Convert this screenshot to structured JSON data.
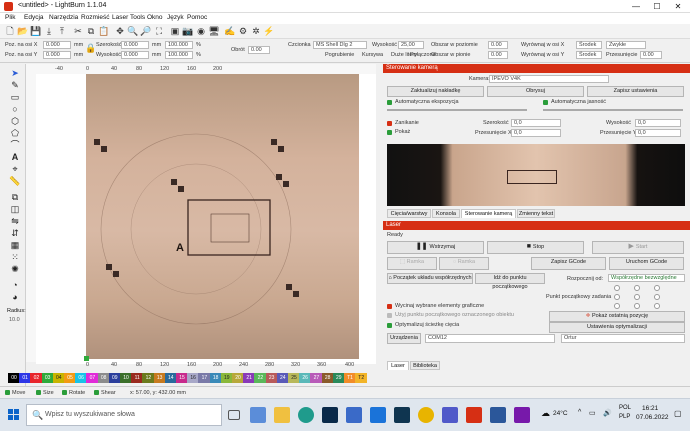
{
  "window": {
    "title": "<untitled> - LightBurn 1.1.04",
    "min": "—",
    "max": "☐",
    "close": "✕"
  },
  "menu": [
    "Plik",
    "Edycja",
    "Narzędzia",
    "Rozmieść",
    "Laser Tools",
    "Okno",
    "Język",
    "Pomoc"
  ],
  "toolbar2": {
    "pos_x_label": "Poz. na osi X",
    "pos_x": "0.000",
    "pos_y_label": "Poz. na osi Y",
    "pos_y": "0.000",
    "unit": "mm",
    "width_label": "Szerokość",
    "width": "0.000",
    "height_label": "Wysokość",
    "height": "0.000",
    "scale_w": "100.000",
    "scale_h": "100.000",
    "pct": "%",
    "rotate_label": "Obrót",
    "rotate": "0.00",
    "font_label": "Czcionka",
    "font": "MS Shell Dlg 2",
    "font_height_label": "Wysokość",
    "font_height": "25,00",
    "hspace_label": "Obszar w poziomie",
    "hspace": "0.00",
    "vspace_label": "Obszar w pionie",
    "vspace": "0.00",
    "bold": "Pogrubienie",
    "italic": "Kursywa",
    "upper": "Duże litery",
    "welded": "Połączone",
    "align_x_label": "Wyrównaj w osi X",
    "align_x": "Środek",
    "align_y_label": "Wyrównaj w osi Y",
    "align_y": "Środek",
    "normal": "Zwykłe",
    "offset_label": "Przesunięcie",
    "offset": "0.00"
  },
  "rulers": {
    "top": [
      "-40",
      "0",
      "40",
      "80",
      "120",
      "160",
      "200",
      "240",
      "280",
      "320",
      "360",
      "400"
    ],
    "left": [
      "400",
      "360",
      "320",
      "280",
      "240",
      "200",
      "160",
      "120",
      "80",
      "40",
      "0"
    ],
    "bottom": [
      "-40",
      "0",
      "40",
      "80",
      "120",
      "160",
      "200",
      "240",
      "280",
      "320",
      "360",
      "400"
    ]
  },
  "radius": {
    "label": "Radius:",
    "value": "10.0"
  },
  "canvas": {
    "marker": "A"
  },
  "palette": [
    {
      "n": "00",
      "c": "#000000"
    },
    {
      "n": "01",
      "c": "#2d36e6"
    },
    {
      "n": "02",
      "c": "#e8252b"
    },
    {
      "n": "03",
      "c": "#2faa3a"
    },
    {
      "n": "04",
      "c": "#c8b400"
    },
    {
      "n": "05",
      "c": "#f29a14"
    },
    {
      "n": "06",
      "c": "#19c3e8"
    },
    {
      "n": "07",
      "c": "#e12ad8"
    },
    {
      "n": "08",
      "c": "#8c8c8c"
    },
    {
      "n": "09",
      "c": "#2c3f9c"
    },
    {
      "n": "10",
      "c": "#3b6f2a"
    },
    {
      "n": "11",
      "c": "#9a2a1e"
    },
    {
      "n": "12",
      "c": "#6b7a1c"
    },
    {
      "n": "13",
      "c": "#c77a1e"
    },
    {
      "n": "14",
      "c": "#2a6a9c"
    },
    {
      "n": "15",
      "c": "#c82a8c"
    },
    {
      "n": "16",
      "c": "#a8a8c8"
    },
    {
      "n": "17",
      "c": "#7a7aa8"
    },
    {
      "n": "18",
      "c": "#3a8ab8"
    },
    {
      "n": "19",
      "c": "#8ab83a"
    },
    {
      "n": "20",
      "c": "#b8a83a"
    },
    {
      "n": "21",
      "c": "#8a3ab8"
    },
    {
      "n": "22",
      "c": "#5ab85a"
    },
    {
      "n": "23",
      "c": "#b85a5a"
    },
    {
      "n": "24",
      "c": "#5a5ab8"
    },
    {
      "n": "25",
      "c": "#b8b85a"
    },
    {
      "n": "26",
      "c": "#5ab8b8"
    },
    {
      "n": "27",
      "c": "#b85ab8"
    },
    {
      "n": "28",
      "c": "#8a5a2a"
    },
    {
      "n": "29",
      "c": "#2a8a5a"
    },
    {
      "n": "T1",
      "c": "#f28c28"
    },
    {
      "n": "T2",
      "c": "#f2b428"
    }
  ],
  "status": {
    "move": "Move",
    "size": "Size",
    "rotate": "Rotate",
    "shear": "Shear",
    "coords": "x: 57.00, y: 432.00 mm"
  },
  "camera": {
    "header": "Sterowanie kamerą",
    "camera_label": "Kamera:",
    "camera": "IPEVO V4K",
    "update_overlay": "Zaktualizuj nakładkę",
    "trace": "Obrysuj",
    "save_settings": "Zapisz ustawienia",
    "auto_exposure": "Automatyczna ekspozycja",
    "auto_brightness": "Automatyczna jasność",
    "fade": "Zanikanie",
    "show": "Pokaż",
    "width_label": "Szerokość",
    "width": "0,0",
    "height_label": "Wysokość",
    "height": "0,0",
    "shift_x_label": "Przesunięcie X",
    "shift_x": "0,0",
    "shift_y_label": "Przesunięcie Y",
    "shift_y": "0,0"
  },
  "tabs1": [
    "Cięcia/warstwy",
    "Konsola",
    "Sterowanie kamerą",
    "Zmienny tekst"
  ],
  "laser": {
    "header": "Laser",
    "status": "Ready",
    "pause": "Wstrzymaj",
    "stop": "Stop",
    "start": "Start",
    "frame1": "Ramka",
    "frame2": "Ramka",
    "save_gcode": "Zapisz GCode",
    "run_gcode": "Uruchom GCode",
    "origin": "Początek układu współrzędnych",
    "go_origin": "Idź do punktu początkowego",
    "start_from_label": "Rozpocznij od:",
    "start_from": "Współrzędne bezwzględne",
    "job_origin": "Punkt początkowy zadania",
    "cut_selected": "Wycinaj wybrane elementy graficzne",
    "use_origin": "Użyj punktu początkowego oznaczonego obiektu",
    "show_last": "Pokaż ostatnią pozycję",
    "optimize": "Optymalizuj ścieżkę cięcia",
    "opt_settings": "Ustawienia optymalizacji",
    "devices": "Urządzenia",
    "port": "COM12",
    "device": "Ortur"
  },
  "tabs2": [
    "Laser",
    "Biblioteka"
  ],
  "taskbar": {
    "search": "Wpisz tu wyszukiwane słowa",
    "temp": "24°C",
    "lang1": "POL",
    "lang2": "PLP",
    "time": "16:21",
    "date": "07.06.2022"
  }
}
